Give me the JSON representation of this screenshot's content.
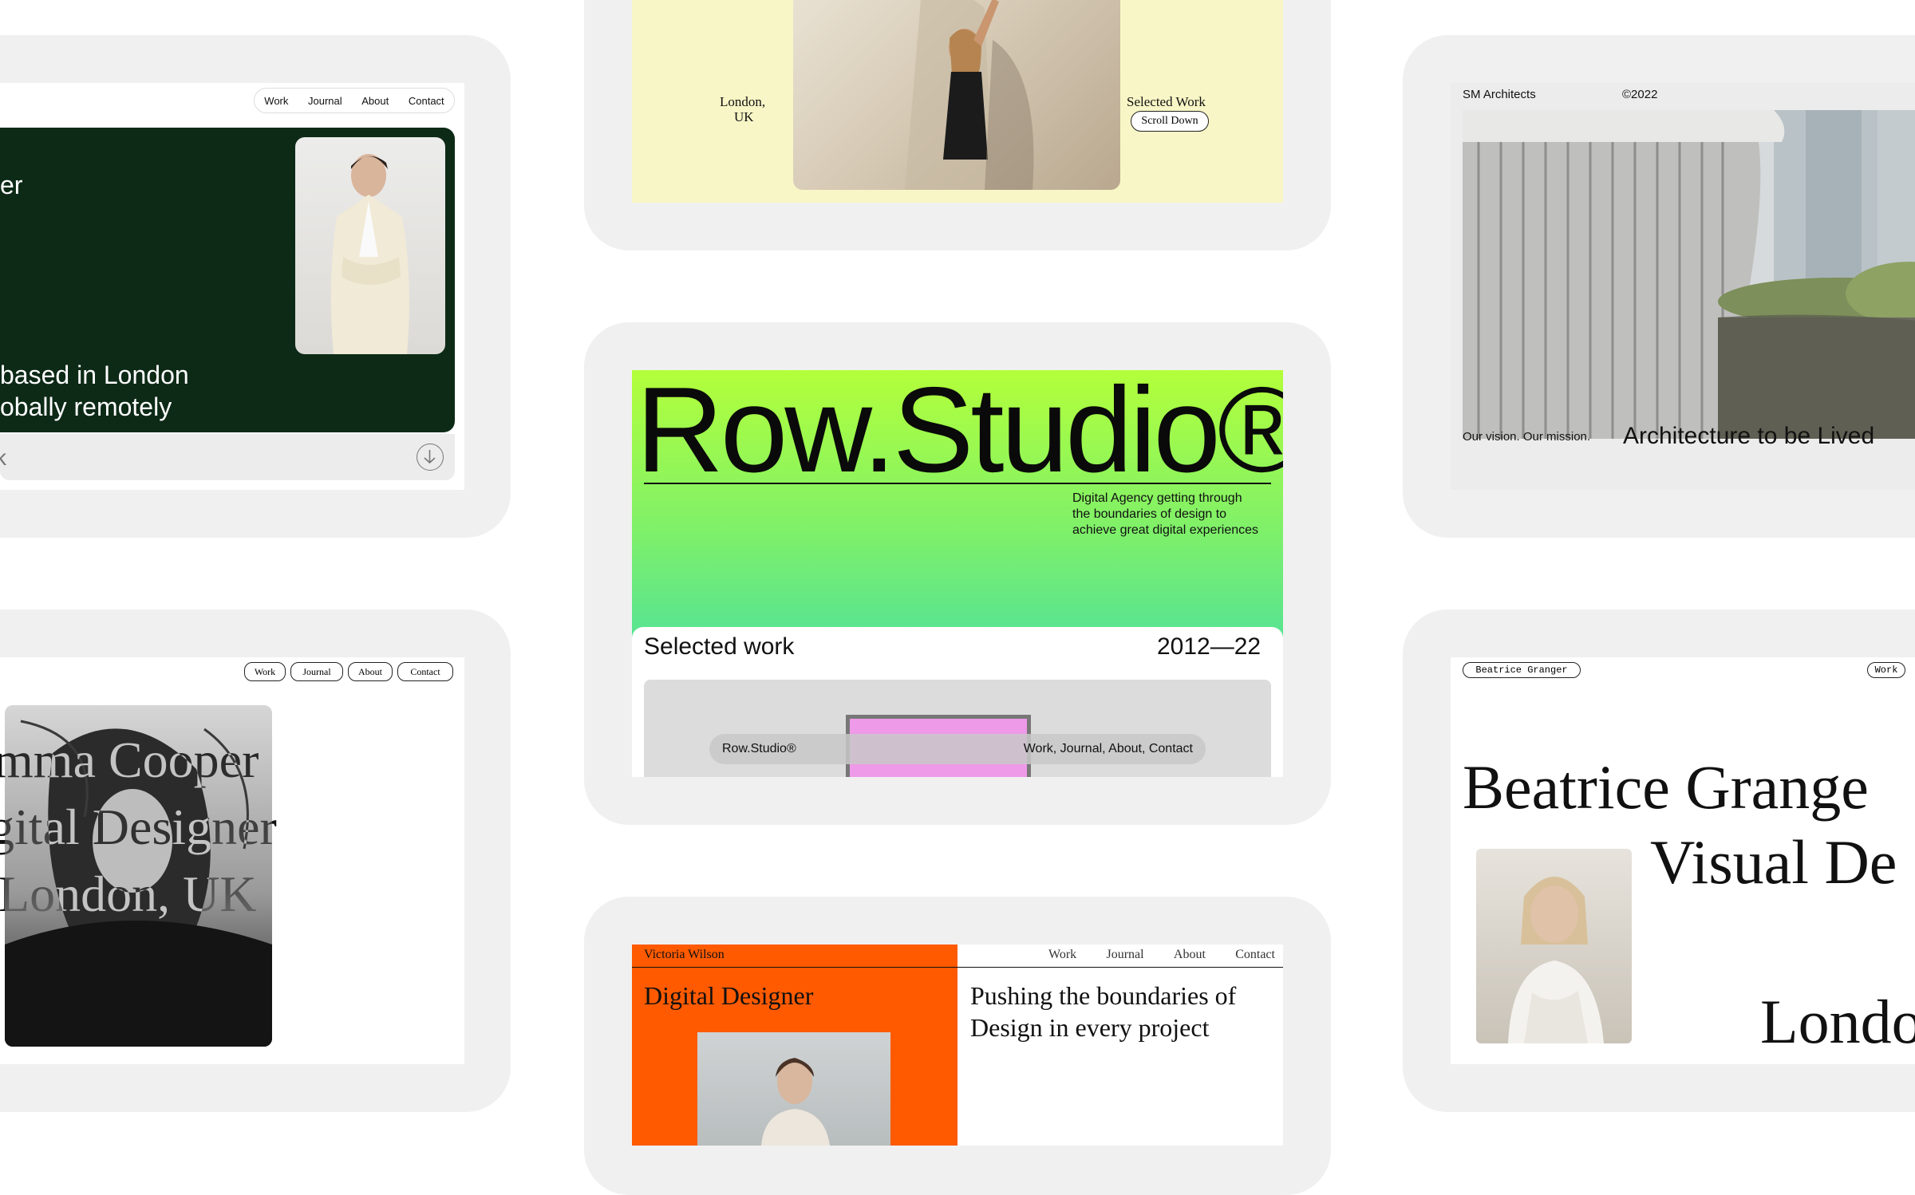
{
  "card_green": {
    "nav": [
      "Work",
      "Journal",
      "About",
      "Contact"
    ],
    "hero_partial": "er",
    "tagline_line1": "based in London",
    "tagline_line2": "obally remotely",
    "footer_partial": "k",
    "accent": "#0d2a17"
  },
  "card_yellow": {
    "location_line1": "London,",
    "location_line2": "UK",
    "selected_work": "Selected Work",
    "scroll_down": "Scroll Down",
    "bg": "#f8f6c6"
  },
  "card_arch": {
    "brand": "SM Architects",
    "year": "©2022",
    "vision": "Our vision. Our mission.",
    "headline": "Architecture to be Lived"
  },
  "card_row": {
    "title": "Row.Studio®",
    "description_line1": "Digital Agency getting through",
    "description_line2": "the boundaries of design to",
    "description_line3": "achieve great digital experiences",
    "selected_work": "Selected work",
    "years": "2012—22",
    "nav_brand": "Row.Studio®",
    "nav_links": "Work, Journal, About, Contact",
    "gradient_top": "#b3ff3a",
    "gradient_bottom": "#22d3c8"
  },
  "card_emma": {
    "nav": [
      "Work",
      "Journal",
      "About",
      "Contact"
    ],
    "line1": "mma Cooper",
    "line2": "gital Designer",
    "line3": "London, UK"
  },
  "card_victoria": {
    "name": "Victoria Wilson",
    "nav": [
      "Work",
      "Journal",
      "About",
      "Contact"
    ],
    "role": "Digital Designer",
    "tagline_line1": "Pushing the boundaries of",
    "tagline_line2": "Design in every project",
    "accent": "#ff5a00"
  },
  "card_beatrice": {
    "name_pill": "Beatrice Granger",
    "work_pill": "Work",
    "line1": "Beatrice Grange",
    "line2": "Visual De",
    "line3": "Londo"
  }
}
